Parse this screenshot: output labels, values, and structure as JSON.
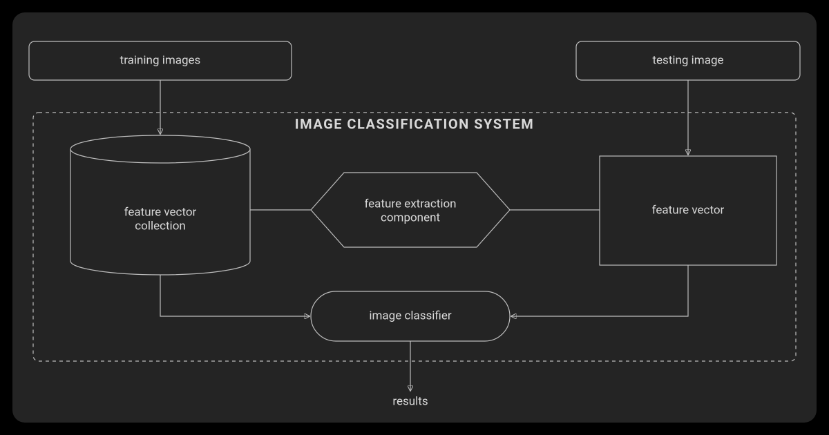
{
  "diagram": {
    "title": "IMAGE CLASSIFICATION SYSTEM",
    "nodes": {
      "training_images": "training images",
      "testing_image": "testing image",
      "feature_vector_collection_l1": "feature vector",
      "feature_vector_collection_l2": "collection",
      "feature_extraction_l1": "feature extraction",
      "feature_extraction_l2": "component",
      "feature_vector": "feature vector",
      "image_classifier": "image classifier",
      "results": "results"
    }
  }
}
